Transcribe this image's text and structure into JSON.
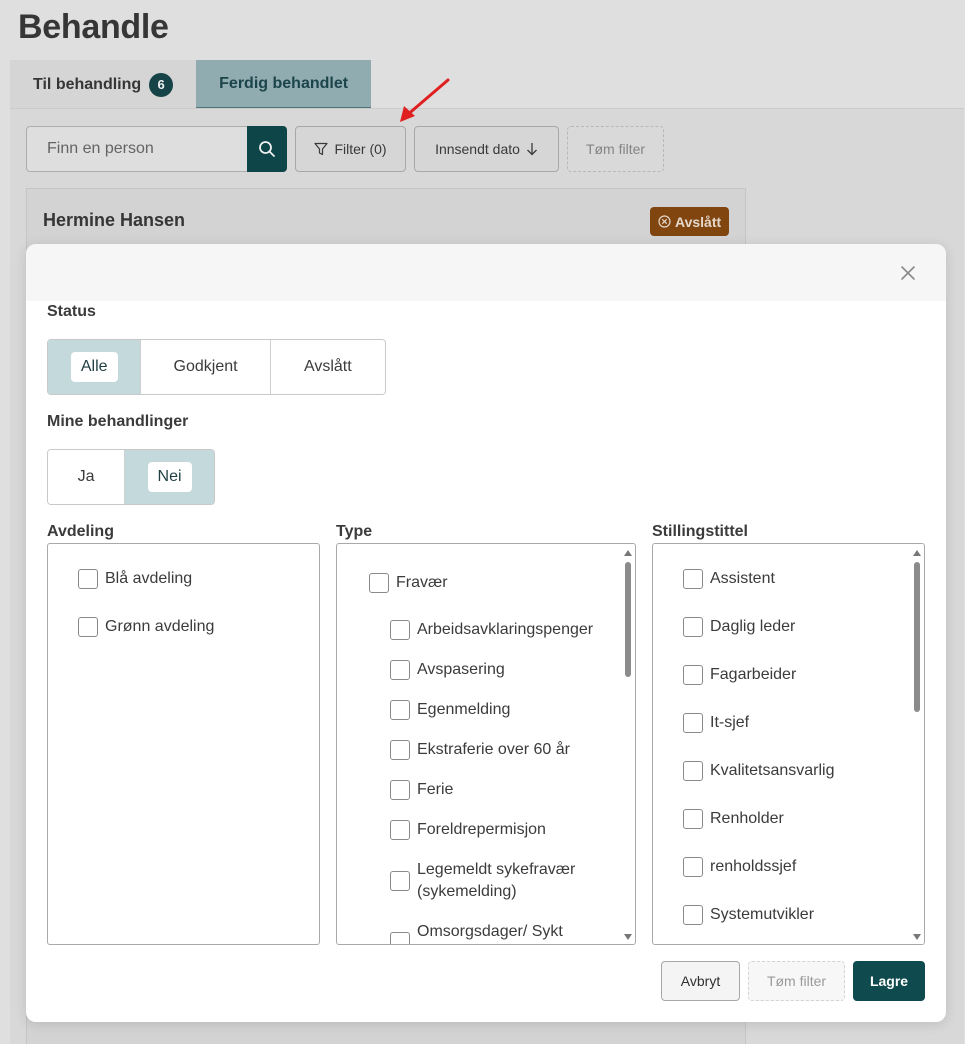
{
  "page": {
    "title": "Behandle",
    "tabs": [
      {
        "label": "Til behandling",
        "count": "6"
      },
      {
        "label": "Ferdig behandlet"
      }
    ],
    "toolbar": {
      "search_placeholder": "Finn en person",
      "filter_label": "Filter (0)",
      "sort_label": "Innsendt dato",
      "clear_label": "Tøm filter"
    },
    "card": {
      "name": "Hermine Hansen",
      "status": "Avslått"
    }
  },
  "modal": {
    "status": {
      "label": "Status",
      "options": [
        "Alle",
        "Godkjent",
        "Avslått"
      ],
      "selected": "Alle"
    },
    "mine": {
      "label": "Mine behandlinger",
      "options": [
        "Ja",
        "Nei"
      ],
      "selected": "Nei"
    },
    "avdeling": {
      "label": "Avdeling",
      "items": [
        "Blå avdeling",
        "Grønn avdeling"
      ]
    },
    "type": {
      "label": "Type",
      "parent": "Fravær",
      "items": [
        "Arbeidsavklaringspenger",
        "Avspasering",
        "Egenmelding",
        "Ekstraferie over 60 år",
        "Ferie",
        "Foreldrepermisjon",
        "Legemeldt sykefravær",
        "(sykemelding)",
        "Omsorgsdager/ Sykt"
      ]
    },
    "stilling": {
      "label": "Stillingstittel",
      "items": [
        "Assistent",
        "Daglig leder",
        "Fagarbeider",
        "It-sjef",
        "Kvalitetsansvarlig",
        "Renholder",
        "renholdssjef",
        "Systemutvikler"
      ]
    },
    "footer": {
      "cancel": "Avbryt",
      "clear": "Tøm filter",
      "save": "Lagre"
    }
  },
  "colors": {
    "accent": "#0e4a4e",
    "selected_toggle": "#c4d9dc",
    "badge_rejected": "#8a4a12",
    "annotation_arrow": "#e02020"
  }
}
